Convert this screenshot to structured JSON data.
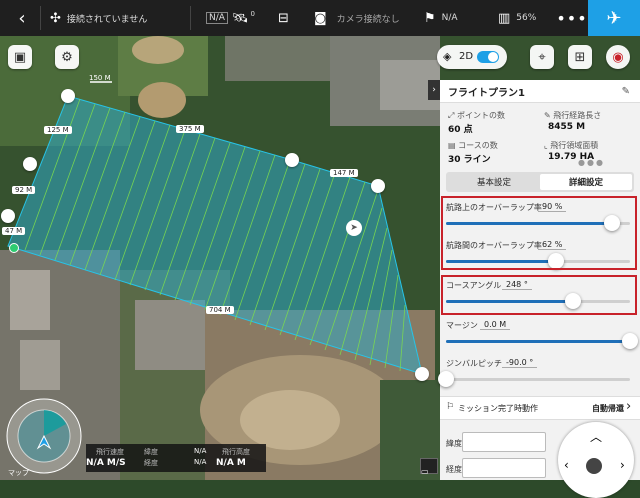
{
  "topbar": {
    "back_icon": "chevron-left-icon",
    "connection_status": "接続されていません",
    "nav_mode": "N/A",
    "satellite_count": "0",
    "camera_status": "カメラ接続なし",
    "signal": "N/A",
    "battery": "56%",
    "more_icon": "more-icon",
    "aircraft_icon": "airplane-icon"
  },
  "map": {
    "scale_label": "150 M",
    "distance_labels": [
      "125 M",
      "375 M",
      "147 M",
      "92 M",
      "47 M",
      "704 M"
    ],
    "toggle_label": "2D"
  },
  "panel": {
    "title": "フライトプラン1",
    "stats": [
      {
        "label": "ポイントの数",
        "value": "60 点"
      },
      {
        "label": "飛行経路長さ",
        "value": "8455 M"
      },
      {
        "label": "コースの数",
        "value": "30 ライン"
      },
      {
        "label": "飛行領域面積",
        "value": "19.79 HA"
      }
    ],
    "tabs": {
      "basic": "基本設定",
      "detail": "詳細設定"
    },
    "sliders": [
      {
        "label": "航路上のオーバーラップ率",
        "value": "90 %",
        "level": 0.9
      },
      {
        "label": "航路間のオーバーラップ率",
        "value": "62 %",
        "level": 0.6
      },
      {
        "label": "コースアングル",
        "value": "248 °",
        "level": 0.69
      },
      {
        "label": "マージン",
        "value": "0.0 M",
        "level": 1.0
      },
      {
        "label": "ジンバルピッチ",
        "value": "-90.0 °",
        "level": 0.0
      }
    ],
    "mission_end_label": "ミッション完了時動作",
    "mission_end_value": "自動帰還",
    "latitude_label": "緯度",
    "longitude_label": "経度"
  },
  "telemetry": {
    "h_speed_label": "飛行速度",
    "h_speed_value": "N/A M/S",
    "lat_label": "緯度",
    "lat_value": "N/A",
    "lon_label": "経度",
    "lon_value": "N/A",
    "alt_label": "飛行高度",
    "alt_value": "N/A M",
    "map_label": "マップ"
  },
  "colors": {
    "accent": "#1ea0e6",
    "slider": "#1f6fb8",
    "highlight": "#c8222a",
    "survey_area": "#2fa9c6"
  }
}
